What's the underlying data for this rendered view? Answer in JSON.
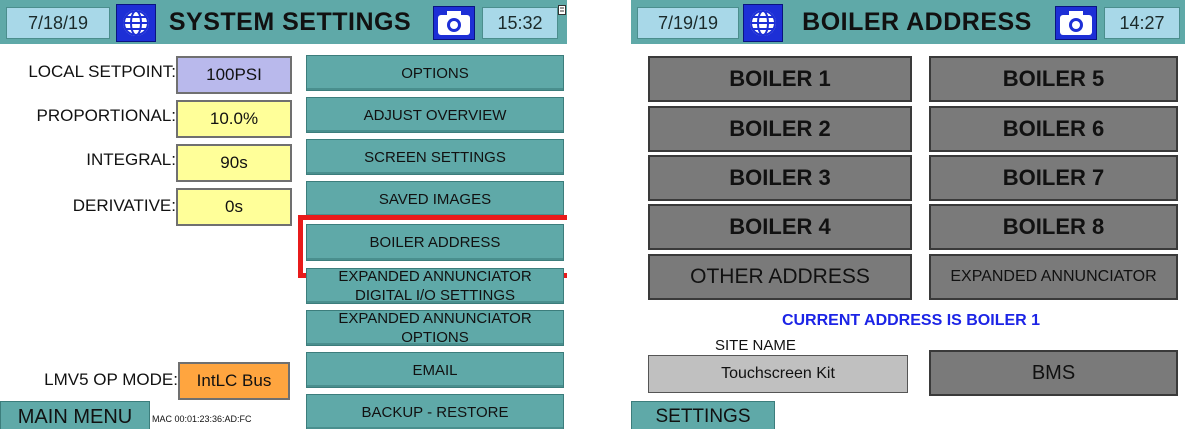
{
  "left": {
    "header": {
      "date": "7/18/19",
      "title": "SYSTEM SETTINGS",
      "time": "15:32"
    },
    "fields": [
      {
        "label": "LOCAL SETPOINT:",
        "value": "100PSI",
        "color": "#b9b9ec"
      },
      {
        "label": "PROPORTIONAL:",
        "value": "10.0%",
        "color": "#ffff99"
      },
      {
        "label": "INTEGRAL:",
        "value": "90s",
        "color": "#ffff99"
      },
      {
        "label": "DERIVATIVE:",
        "value": "0s",
        "color": "#ffff99"
      }
    ],
    "op_mode": {
      "label": "LMV5 OP MODE:",
      "value": "IntLC Bus",
      "color": "#ffa53f"
    },
    "buttons": {
      "options": "OPTIONS",
      "adjust_overview": "ADJUST OVERVIEW",
      "screen_settings": "SCREEN SETTINGS",
      "saved_images": "SAVED IMAGES",
      "boiler_address": "BOILER ADDRESS",
      "exp_dio_1": "EXPANDED ANNUNCIATOR",
      "exp_dio_2": "DIGITAL I/O SETTINGS",
      "exp_opt_1": "EXPANDED ANNUNCIATOR",
      "exp_opt_2": "OPTIONS",
      "email": "EMAIL",
      "backup_restore": "BACKUP - RESTORE"
    },
    "main_menu": "MAIN MENU",
    "mac": "MAC 00:01:23:36:AD:FC"
  },
  "right": {
    "header": {
      "date": "7/19/19",
      "title": "BOILER ADDRESS",
      "time": "14:27"
    },
    "boilers": [
      "BOILER 1",
      "BOILER 5",
      "BOILER 2",
      "BOILER 6",
      "BOILER 3",
      "BOILER 7",
      "BOILER 4",
      "BOILER 8"
    ],
    "other_address": "OTHER ADDRESS",
    "expanded_annunciator": "EXPANDED ANNUNCIATOR",
    "current_address": "CURRENT ADDRESS IS BOILER 1",
    "site_name_label": "SITE NAME",
    "site_name_value": "Touchscreen Kit",
    "bms": "BMS",
    "settings_tab": "SETTINGS"
  },
  "colors": {
    "header_teal": "#5fa9a8",
    "current_address_blue": "#1c24e6",
    "highlight_red": "#e81b1b",
    "boiler_gray": "#7a7a7a"
  }
}
